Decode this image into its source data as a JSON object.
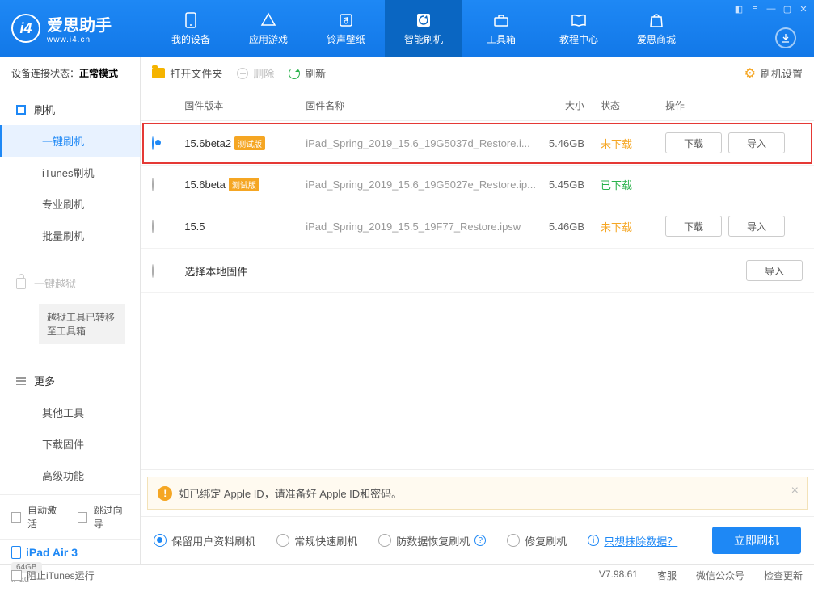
{
  "app": {
    "name": "爱思助手",
    "url": "www.i4.cn"
  },
  "nav": {
    "items": [
      {
        "label": "我的设备"
      },
      {
        "label": "应用游戏"
      },
      {
        "label": "铃声壁纸"
      },
      {
        "label": "智能刷机"
      },
      {
        "label": "工具箱"
      },
      {
        "label": "教程中心"
      },
      {
        "label": "爱思商城"
      }
    ]
  },
  "sidebar": {
    "status_label": "设备连接状态：",
    "status_value": "正常模式",
    "flash_head": "刷机",
    "flash_items": [
      "一键刷机",
      "iTunes刷机",
      "专业刷机",
      "批量刷机"
    ],
    "jailbreak_head": "一键越狱",
    "jailbreak_note": "越狱工具已转移至工具箱",
    "more_head": "更多",
    "more_items": [
      "其他工具",
      "下载固件",
      "高级功能"
    ],
    "auto_activate": "自动激活",
    "skip_guide": "跳过向导",
    "device": {
      "name": "iPad Air 3",
      "storage": "64GB",
      "type": "iPad"
    }
  },
  "toolbar": {
    "open": "打开文件夹",
    "delete": "删除",
    "refresh": "刷新",
    "settings": "刷机设置"
  },
  "table": {
    "headers": {
      "version": "固件版本",
      "name": "固件名称",
      "size": "大小",
      "status": "状态",
      "ops": "操作"
    },
    "beta_tag": "测试版",
    "btn_download": "下载",
    "btn_import": "导入",
    "local_label": "选择本地固件",
    "rows": [
      {
        "version": "15.6beta2",
        "beta": true,
        "name": "iPad_Spring_2019_15.6_19G5037d_Restore.i...",
        "size": "5.46GB",
        "status": "未下载",
        "status_cls": "st-undl",
        "selected": true,
        "hl": true,
        "show_dl": true
      },
      {
        "version": "15.6beta",
        "beta": true,
        "name": "iPad_Spring_2019_15.6_19G5027e_Restore.ip...",
        "size": "5.45GB",
        "status": "已下载",
        "status_cls": "st-dl",
        "selected": false,
        "hl": false,
        "show_dl": false
      },
      {
        "version": "15.5",
        "beta": false,
        "name": "iPad_Spring_2019_15.5_19F77_Restore.ipsw",
        "size": "5.46GB",
        "status": "未下载",
        "status_cls": "st-undl",
        "selected": false,
        "hl": false,
        "show_dl": true
      }
    ]
  },
  "warn": {
    "text": "如已绑定 Apple ID，请准备好 Apple ID和密码。"
  },
  "options": {
    "opts": [
      "保留用户资料刷机",
      "常规快速刷机",
      "防数据恢复刷机",
      "修复刷机"
    ],
    "erase_link": "只想抹除数据？",
    "flash_btn": "立即刷机"
  },
  "footer": {
    "block_itunes": "阻止iTunes运行",
    "version": "V7.98.61",
    "links": [
      "客服",
      "微信公众号",
      "检查更新"
    ]
  }
}
